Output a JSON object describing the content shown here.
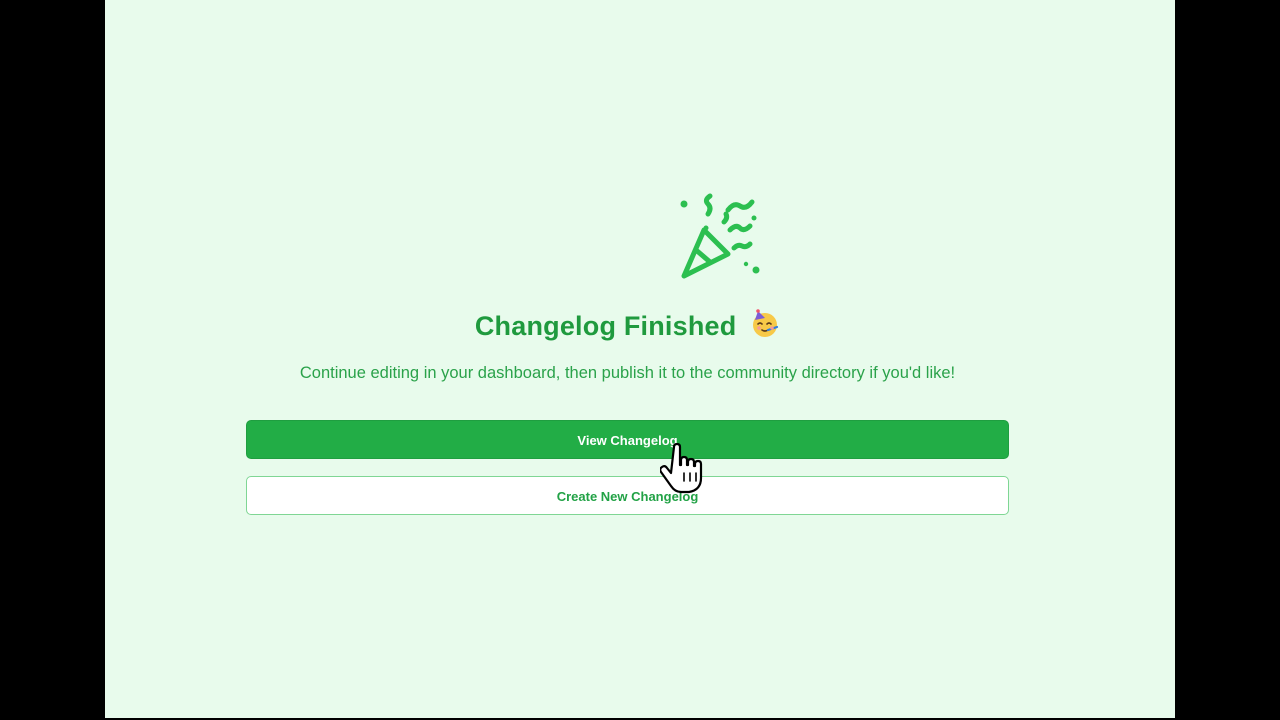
{
  "dialog": {
    "title": "Changelog Finished",
    "title_emoji": "partying-face-icon",
    "hero_icon": "party-popper-icon",
    "message": "Continue editing in your dashboard, then publish it to the community directory if you'd like!",
    "primary_button_label": "View Changelog",
    "secondary_button_label": "Create New Changelog"
  },
  "colors": {
    "background": "#e8fbec",
    "accent": "#22ad46",
    "title_text": "#1f9a3e",
    "message_text": "#2aa24a"
  },
  "cursor": {
    "type": "hand-pointer-icon"
  }
}
